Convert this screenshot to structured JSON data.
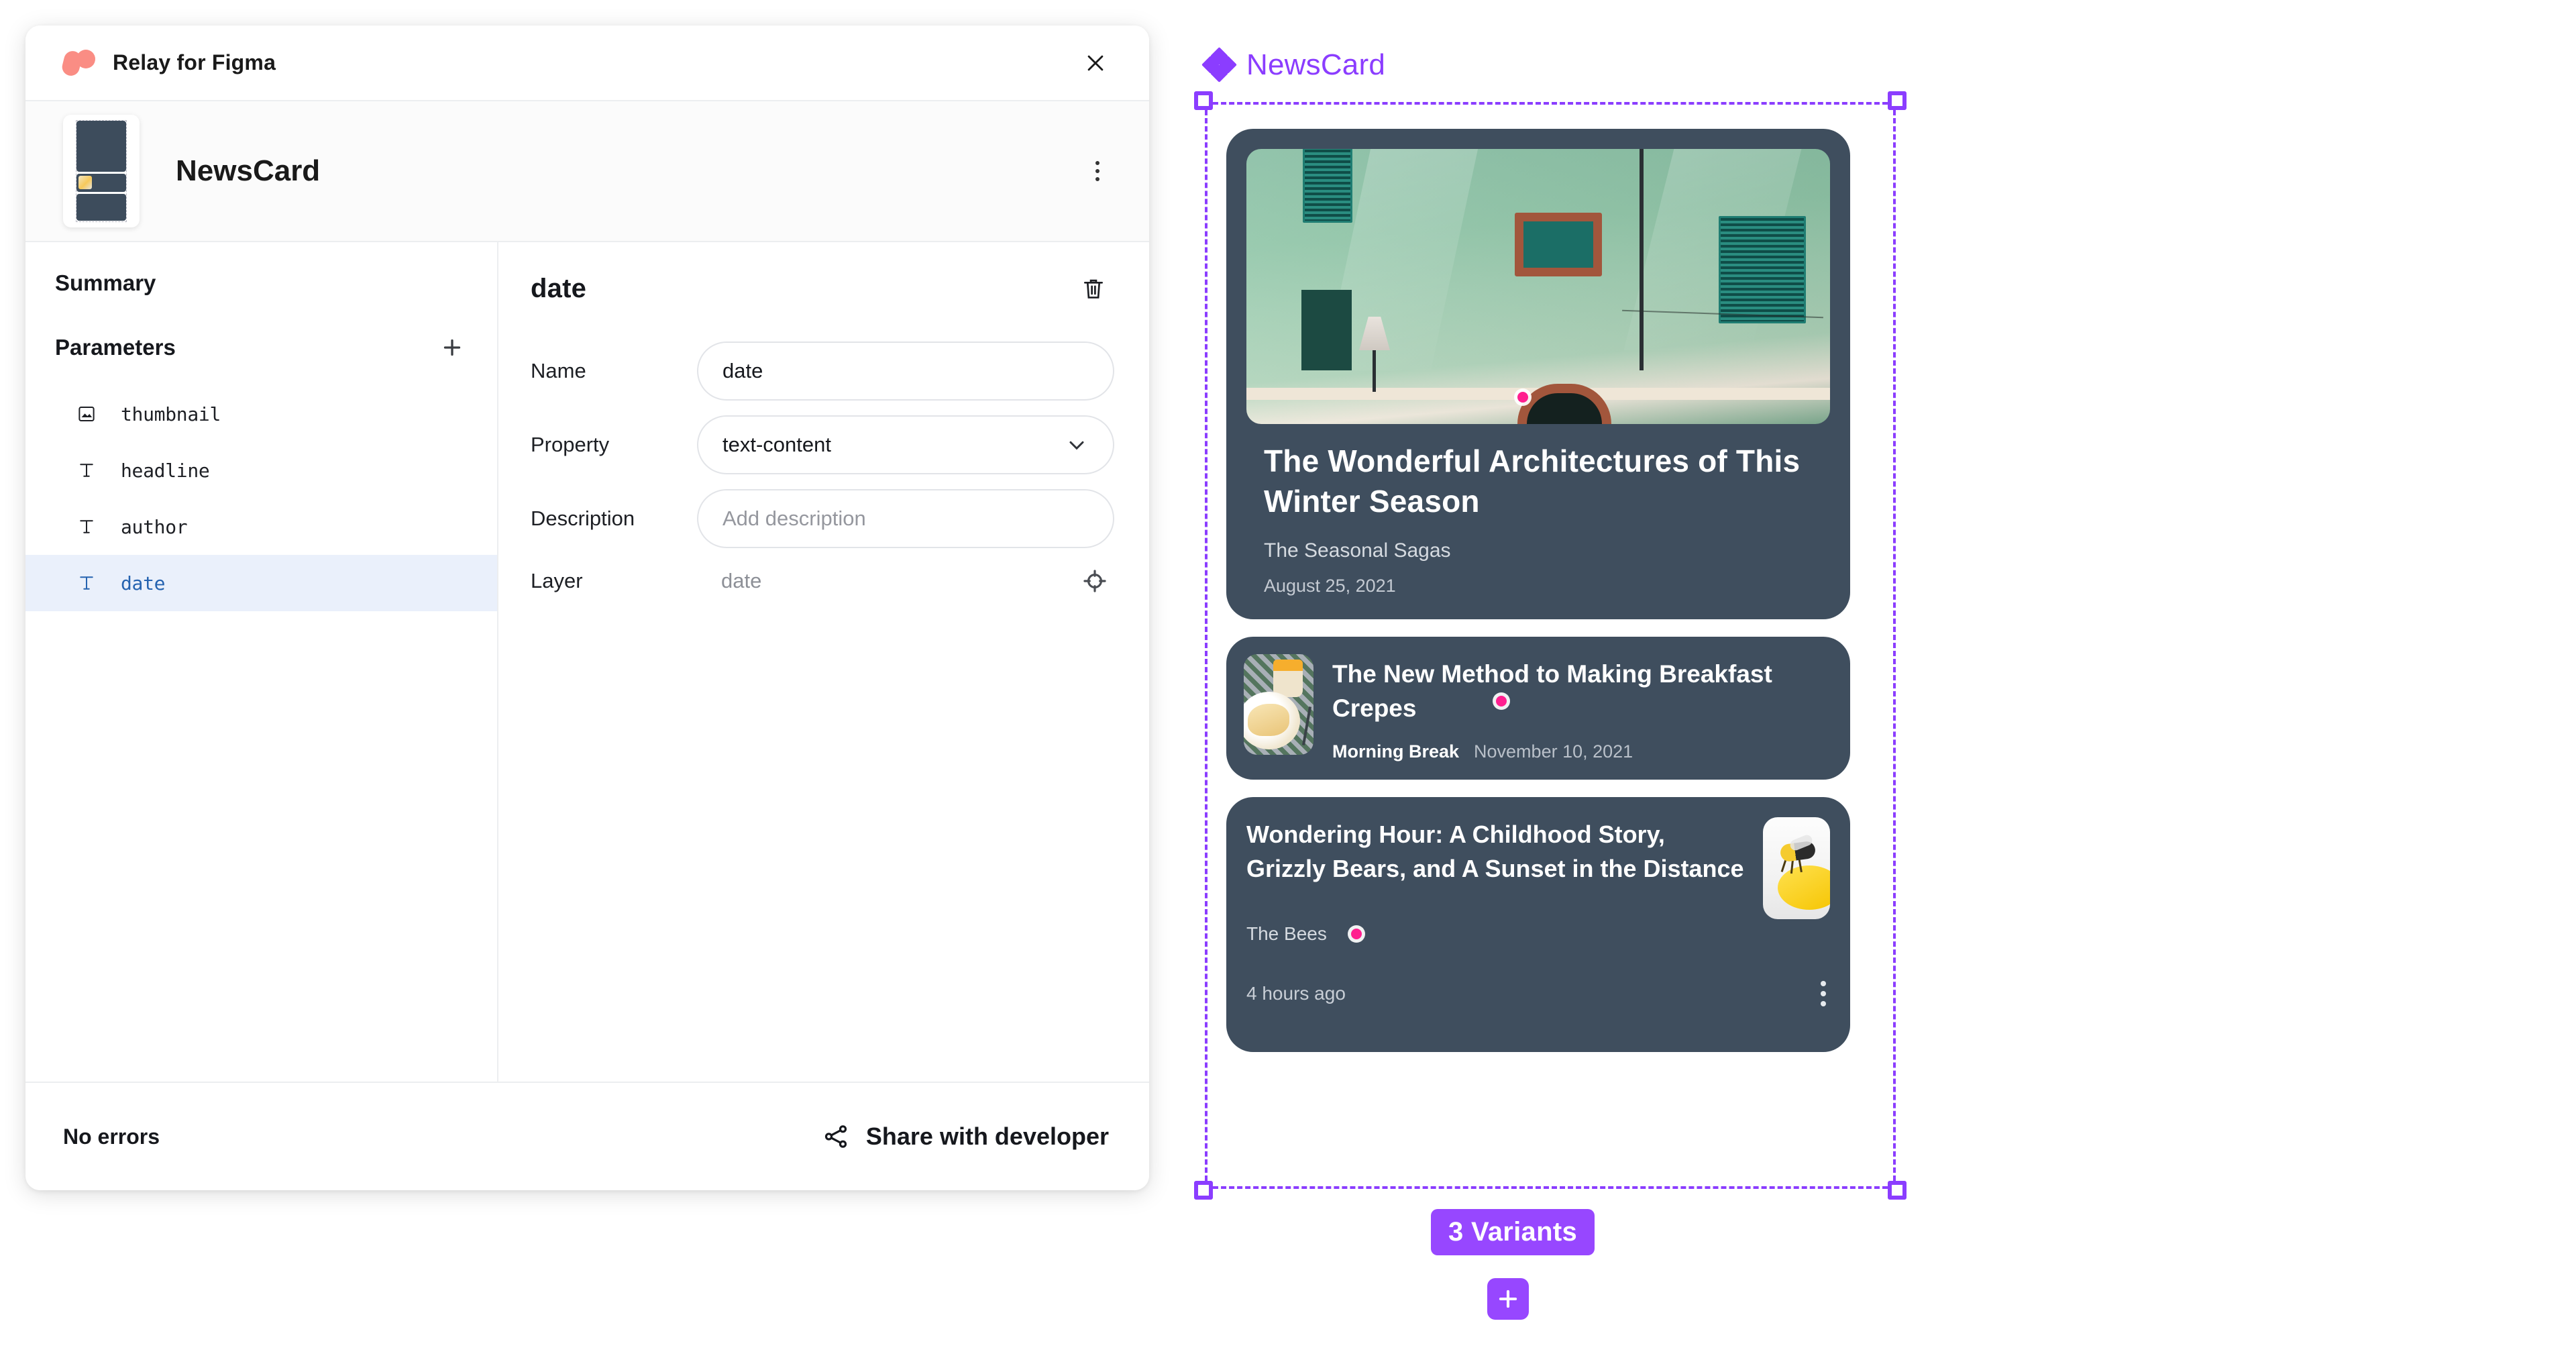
{
  "plugin": {
    "title": "Relay for Figma",
    "logo_icon": "relay-logo",
    "close_icon": "close-icon",
    "component_name": "NewsCard",
    "kebab_icon": "more-vertical-icon",
    "thumbnail_icon": "component-thumbnail"
  },
  "sidebar": {
    "summary_label": "Summary",
    "parameters_label": "Parameters",
    "add_icon": "plus-icon",
    "parameters": [
      {
        "label": "thumbnail",
        "icon": "image-icon",
        "type": "image",
        "selected": false
      },
      {
        "label": "headline",
        "icon": "text-icon",
        "type": "text",
        "selected": false
      },
      {
        "label": "author",
        "icon": "text-icon",
        "type": "text",
        "selected": false
      },
      {
        "label": "date",
        "icon": "text-icon",
        "type": "text",
        "selected": true
      }
    ]
  },
  "detail": {
    "title": "date",
    "delete_icon": "trash-icon",
    "name_label": "Name",
    "name_value": "date",
    "property_label": "Property",
    "property_value": "text-content",
    "property_chevron_icon": "chevron-down-icon",
    "description_label": "Description",
    "description_value": "",
    "description_placeholder": "Add description",
    "layer_label": "Layer",
    "layer_value": "date",
    "locate_icon": "target-icon"
  },
  "footer": {
    "status": "No errors",
    "share_label": "Share with developer",
    "share_icon": "share-icon"
  },
  "canvas": {
    "component_label": "NewsCard",
    "component_icon": "component-set-diamond-icon",
    "variants_badge": "3 Variants",
    "add_variant_icon": "plus-icon",
    "cards": [
      {
        "variant": "large",
        "headline": "The Wonderful Architectures of This Winter Season",
        "author": "The Seasonal Sagas",
        "date": "August 25, 2021",
        "thumbnail_alt": "green building facade with shutters"
      },
      {
        "variant": "compact",
        "headline": "The New Method to Making Breakfast Crepes",
        "author": "Morning Break",
        "date": "November 10, 2021",
        "thumbnail_alt": "crepes on a plate"
      },
      {
        "variant": "medium",
        "headline": "Wondering Hour: A Childhood Story, Grizzly Bears, and A Sunset in the Distance",
        "author": "The Bees",
        "date": "4 hours ago",
        "thumbnail_alt": "bee on a yellow object",
        "kebab_icon": "more-vertical-icon"
      }
    ]
  },
  "colors": {
    "accent_purple": "#8B3DFF",
    "variant_purple": "#9747FF",
    "card_bg": "#3F4E5E",
    "selected_row_bg": "#EAF0FB",
    "selected_row_text": "#2563B0",
    "relay_coral": "#FA8D84",
    "annotation_pink": "#FF1F8F"
  }
}
